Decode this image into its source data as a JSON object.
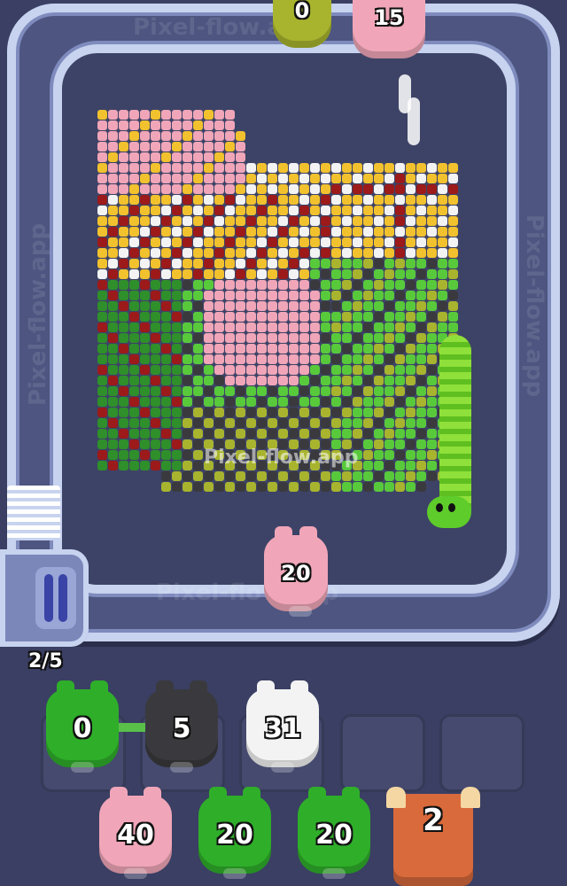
{
  "watermark": "Pixel-flow.app",
  "progress": {
    "text": "2/5",
    "current": 2,
    "total": 5
  },
  "conveyor": {
    "top_pigs": [
      {
        "count": "0",
        "color": "#a8b42e"
      },
      {
        "count": "15",
        "color": "#f0a6b8"
      }
    ],
    "active_pig": {
      "count": "20",
      "color": "#f0a6b8"
    }
  },
  "queue_slots": [
    {
      "count": "0",
      "color": "#2fae2a"
    },
    {
      "count": "5",
      "color": "#3a3a3e"
    },
    {
      "count": "31",
      "color": "#f3f3f3"
    },
    {
      "count": "",
      "color": ""
    },
    {
      "count": "",
      "color": ""
    }
  ],
  "waiting_pigs": [
    {
      "count": "40",
      "color": "#f0a6b8"
    },
    {
      "count": "20",
      "color": "#2fae2a"
    },
    {
      "count": "20",
      "color": "#2fae2a"
    }
  ],
  "bull": {
    "count": "2",
    "color": "#d96a3c"
  },
  "palette": {
    "pink": "#f0a6b8",
    "yellow": "#f2c12e",
    "white": "#f3f3f3",
    "darkred": "#9c1a1a",
    "green": "#58c93b",
    "darkgreen": "#2f8f2a",
    "olive": "#a8b42e",
    "dark": "#3a3a3e"
  }
}
